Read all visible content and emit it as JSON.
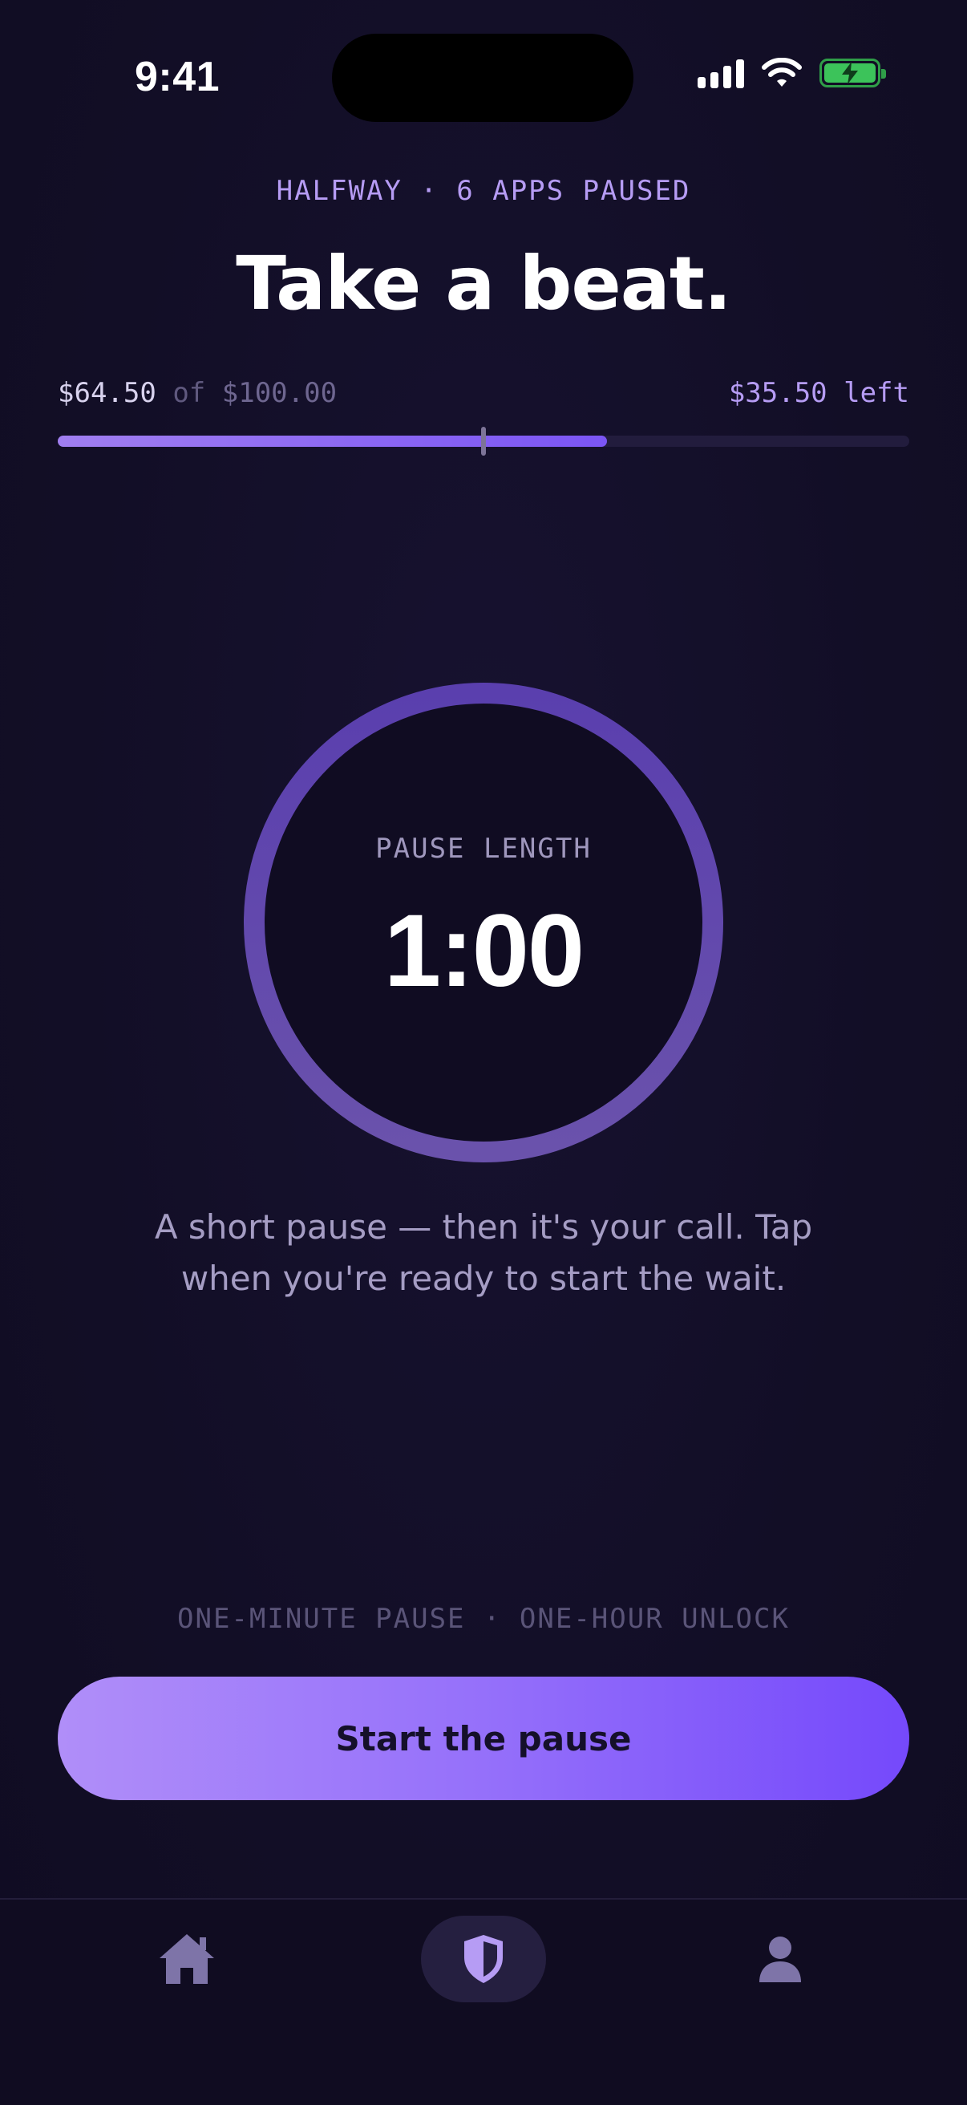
{
  "status_bar": {
    "time": "9:41",
    "icons": [
      "cellular-signal-icon",
      "wifi-icon",
      "battery-charging-icon"
    ]
  },
  "header": {
    "kicker": "HALFWAY · 6 APPS PAUSED",
    "title": "Take a beat."
  },
  "budget": {
    "spent": "$64.50",
    "of_label": "of",
    "total": "$100.00",
    "remaining": "$35.50 left",
    "progress_fraction": 0.645,
    "midpoint_marker_fraction": 0.5
  },
  "timer": {
    "label": "PAUSE LENGTH",
    "value": "1:00"
  },
  "description": "A short pause — then it's your call. Tap when you're ready to start the wait.",
  "rule_text": "ONE-MINUTE PAUSE · ONE-HOUR UNLOCK",
  "cta": {
    "label": "Start the pause"
  },
  "tab_bar": {
    "items": [
      {
        "icon": "home-icon",
        "active": false
      },
      {
        "icon": "shield-icon",
        "active": true
      },
      {
        "icon": "profile-icon",
        "active": false
      }
    ]
  },
  "colors": {
    "background": "#130f27",
    "accent": "#b69cf4",
    "accent_strong": "#7549fb",
    "ring": "#5b45a8",
    "battery": "#3cc35a"
  }
}
